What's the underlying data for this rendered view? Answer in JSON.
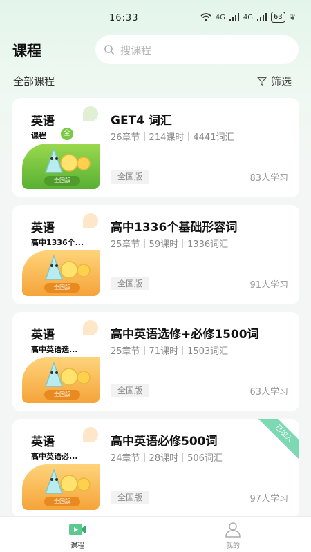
{
  "status_bar": {
    "time": "16:33",
    "network_1": "4G",
    "network_2": "4G",
    "battery": "63"
  },
  "header": {
    "title": "课程",
    "search_placeholder": "搜课程"
  },
  "sub_header": {
    "section_title": "全部课程",
    "filter_label": "筛选"
  },
  "courses": [
    {
      "theme": "green",
      "thumb_subject": "英语",
      "thumb_sub": "课程",
      "thumb_badge": "全",
      "thumb_edition": "全国版",
      "title": "GET4 词汇",
      "chapters": "26章节",
      "hours": "214课时",
      "words": "4441词汇",
      "version": "全国版",
      "learners": "83人学习",
      "joined": ""
    },
    {
      "theme": "orange",
      "thumb_subject": "英语",
      "thumb_sub": "高中1336个...",
      "thumb_badge": "",
      "thumb_edition": "全国版",
      "title": "高中1336个基础形容词",
      "chapters": "25章节",
      "hours": "59课时",
      "words": "1336词汇",
      "version": "全国版",
      "learners": "91人学习",
      "joined": ""
    },
    {
      "theme": "orange",
      "thumb_subject": "英语",
      "thumb_sub": "高中英语选...",
      "thumb_badge": "",
      "thumb_edition": "全国版",
      "title": "高中英语选修+必修1500词",
      "chapters": "25章节",
      "hours": "71课时",
      "words": "1503词汇",
      "version": "全国版",
      "learners": "63人学习",
      "joined": ""
    },
    {
      "theme": "orange",
      "thumb_subject": "英语",
      "thumb_sub": "高中英语必...",
      "thumb_badge": "",
      "thumb_edition": "全国版",
      "title": "高中英语必修500词",
      "chapters": "24章节",
      "hours": "28课时",
      "words": "506词汇",
      "version": "全国版",
      "learners": "97人学习",
      "joined": "已加入"
    }
  ],
  "bottom_nav": {
    "courses_label": "课程",
    "mine_label": "我的"
  },
  "colors": {
    "accent_green": "#5cc98f",
    "ribbon": "#7dd8b4"
  }
}
